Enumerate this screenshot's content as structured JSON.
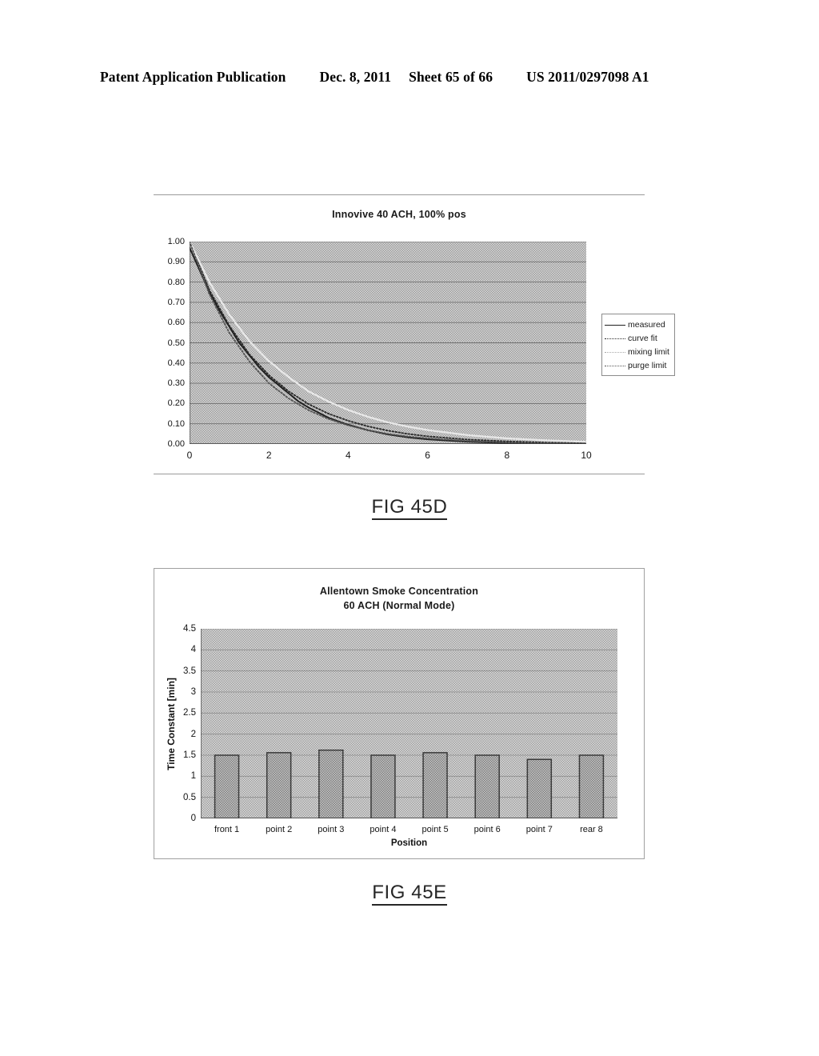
{
  "page_header": {
    "publication": "Patent Application Publication",
    "date": "Dec. 8, 2011",
    "sheet": "Sheet 65 of 66",
    "doc_number": "US 2011/0297098 A1"
  },
  "figures": [
    {
      "caption": "FIG 45D"
    },
    {
      "caption": "FIG 45E"
    }
  ],
  "chart_data": [
    {
      "type": "line",
      "title": "Innovive 40 ACH, 100% pos",
      "xlabel": "",
      "ylabel": "",
      "xlim": [
        0,
        10
      ],
      "ylim": [
        0.0,
        1.0
      ],
      "xticks": [
        0,
        2,
        4,
        6,
        8,
        10
      ],
      "xtick_labels": [
        "0",
        "2",
        "4",
        "6",
        "8",
        "10"
      ],
      "yticks": [
        0.0,
        0.1,
        0.2,
        0.3,
        0.4,
        0.5,
        0.6,
        0.7,
        0.8,
        0.9,
        1.0
      ],
      "ytick_labels": [
        "0.00",
        "0.10",
        "0.20",
        "0.30",
        "0.40",
        "0.50",
        "0.60",
        "0.70",
        "0.80",
        "0.90",
        "1.00"
      ],
      "grid": true,
      "plot_background": "#c9c9c9",
      "legend_position": "right",
      "legend": [
        "measured",
        "curve fit",
        "mixing limit",
        "purge limit"
      ],
      "series": [
        {
          "name": "measured",
          "style": "solid",
          "color": "#1f1f1f",
          "x": [
            0.0,
            0.25,
            0.5,
            0.75,
            1.0,
            1.25,
            1.5,
            1.75,
            2.0,
            2.25,
            2.5,
            2.75,
            3.0,
            3.25,
            3.5,
            3.75,
            4.0,
            4.5,
            5.0,
            5.5,
            6.0,
            7.0,
            8.0,
            9.0,
            10.0
          ],
          "y": [
            0.97,
            0.86,
            0.75,
            0.66,
            0.58,
            0.5,
            0.44,
            0.38,
            0.33,
            0.29,
            0.25,
            0.21,
            0.18,
            0.155,
            0.13,
            0.112,
            0.095,
            0.068,
            0.047,
            0.033,
            0.023,
            0.011,
            0.005,
            0.003,
            0.002
          ]
        },
        {
          "name": "curve fit",
          "style": "dotted",
          "color": "#2b2b2b",
          "x": [
            0.0,
            0.5,
            1.0,
            1.5,
            2.0,
            2.5,
            3.0,
            3.5,
            4.0,
            4.5,
            5.0,
            5.5,
            6.0,
            7.0,
            8.0,
            9.0,
            10.0
          ],
          "y": [
            1.0,
            0.76,
            0.585,
            0.445,
            0.34,
            0.26,
            0.197,
            0.15,
            0.115,
            0.087,
            0.066,
            0.05,
            0.038,
            0.022,
            0.013,
            0.007,
            0.004
          ]
        },
        {
          "name": "mixing limit",
          "style": "dotted-light",
          "color": "#e8e8e8",
          "x": [
            0.0,
            0.5,
            1.0,
            1.5,
            2.0,
            2.5,
            3.0,
            3.5,
            4.0,
            4.5,
            5.0,
            5.5,
            6.0,
            7.0,
            8.0,
            9.0,
            10.0
          ],
          "y": [
            1.0,
            0.8,
            0.64,
            0.51,
            0.41,
            0.33,
            0.26,
            0.21,
            0.168,
            0.134,
            0.107,
            0.086,
            0.069,
            0.044,
            0.028,
            0.018,
            0.011
          ]
        },
        {
          "name": "purge limit",
          "style": "dotted",
          "color": "#555555",
          "x": [
            0.0,
            0.5,
            1.0,
            1.5,
            2.0,
            2.5,
            3.0,
            3.5,
            4.0,
            4.5,
            5.0,
            5.5,
            6.0,
            7.0,
            8.0,
            9.0,
            10.0
          ],
          "y": [
            1.0,
            0.74,
            0.55,
            0.41,
            0.3,
            0.225,
            0.167,
            0.124,
            0.092,
            0.068,
            0.05,
            0.037,
            0.028,
            0.015,
            0.008,
            0.004,
            0.002
          ]
        }
      ]
    },
    {
      "type": "bar",
      "title_line1": "Allentown Smoke Concentration",
      "title_line2": "60 ACH (Normal Mode)",
      "xlabel": "Position",
      "ylabel": "Time Constant [min]",
      "categories": [
        "front 1",
        "point 2",
        "point 3",
        "point 4",
        "point 5",
        "point 6",
        "point 7",
        "rear 8"
      ],
      "values": [
        1.5,
        1.56,
        1.62,
        1.5,
        1.56,
        1.5,
        1.4,
        1.5
      ],
      "ylim": [
        0,
        4.5
      ],
      "yticks": [
        0,
        0.5,
        1,
        1.5,
        2,
        2.5,
        3,
        3.5,
        4,
        4.5
      ],
      "ytick_labels": [
        "0",
        "0.5",
        "1",
        "1.5",
        "2",
        "2.5",
        "3",
        "3.5",
        "4",
        "4.5"
      ],
      "grid": true,
      "plot_background": "#c9c9c9",
      "bar_fill": "#b4b4b4",
      "bar_edge": "#3a3a3a",
      "legend_position": "none"
    }
  ]
}
